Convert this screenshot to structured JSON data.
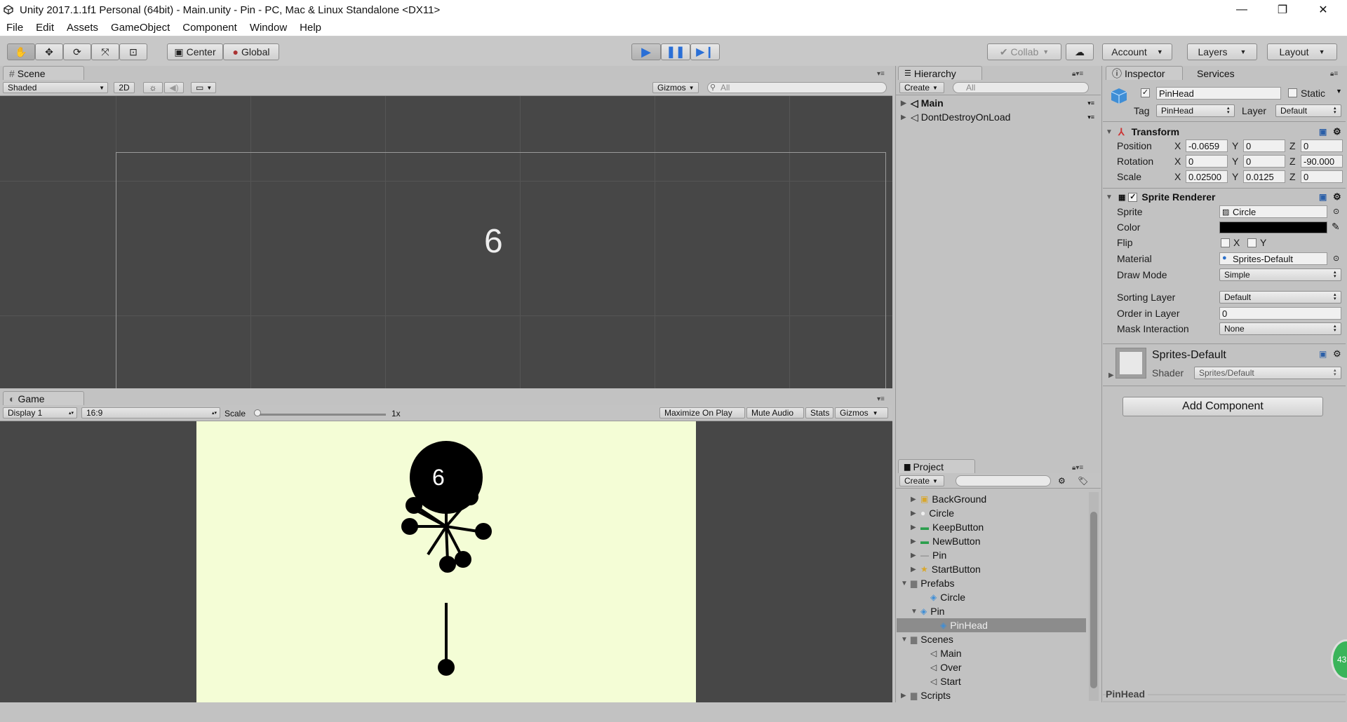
{
  "window": {
    "title": "Unity 2017.1.1f1 Personal (64bit) - Main.unity - Pin - PC, Mac & Linux Standalone <DX11>"
  },
  "menu": [
    "File",
    "Edit",
    "Assets",
    "GameObject",
    "Component",
    "Window",
    "Help"
  ],
  "toolbar": {
    "center": "Center",
    "global": "Global",
    "collab": "Collab",
    "account": "Account",
    "layers": "Layers",
    "layout": "Layout"
  },
  "scene": {
    "tab": "Scene",
    "shading": "Shaded",
    "mode2d": "2D",
    "gizmos": "Gizmos",
    "search_placeholder": "All",
    "overlay_number": "6"
  },
  "game": {
    "tab": "Game",
    "display": "Display 1",
    "aspect": "16:9",
    "scale_label": "Scale",
    "scale_value": "1x",
    "maximize": "Maximize On Play",
    "mute": "Mute Audio",
    "stats": "Stats",
    "gizmos": "Gizmos",
    "score": "6",
    "background_color": "#f4fdd6"
  },
  "hierarchy": {
    "tab": "Hierarchy",
    "create": "Create",
    "search_placeholder": "All",
    "items": [
      "Main",
      "DontDestroyOnLoad"
    ]
  },
  "project": {
    "tab": "Project",
    "create": "Create",
    "items": [
      {
        "label": "BackGround",
        "icon": "sprite-icon",
        "indent": 1,
        "arrow": "right"
      },
      {
        "label": "Circle",
        "icon": "circle-sprite-icon",
        "indent": 1,
        "arrow": "right"
      },
      {
        "label": "KeepButton",
        "icon": "button-sprite-icon",
        "indent": 1,
        "arrow": "right"
      },
      {
        "label": "NewButton",
        "icon": "button-sprite-icon",
        "indent": 1,
        "arrow": "right"
      },
      {
        "label": "Pin",
        "icon": "line-sprite-icon",
        "indent": 1,
        "arrow": "right"
      },
      {
        "label": "StartButton",
        "icon": "star-sprite-icon",
        "indent": 1,
        "arrow": "right"
      },
      {
        "label": "Prefabs",
        "icon": "folder-icon",
        "indent": 0,
        "arrow": "down"
      },
      {
        "label": "Circle",
        "icon": "prefab-icon",
        "indent": 2,
        "arrow": ""
      },
      {
        "label": "Pin",
        "icon": "prefab-icon",
        "indent": 1,
        "arrow": "down"
      },
      {
        "label": "PinHead",
        "icon": "prefab-icon",
        "indent": 3,
        "arrow": "",
        "selected": true
      },
      {
        "label": "Scenes",
        "icon": "folder-icon",
        "indent": 0,
        "arrow": "down"
      },
      {
        "label": "Main",
        "icon": "unity-scene-icon",
        "indent": 2,
        "arrow": ""
      },
      {
        "label": "Over",
        "icon": "unity-scene-icon",
        "indent": 2,
        "arrow": ""
      },
      {
        "label": "Start",
        "icon": "unity-scene-icon",
        "indent": 2,
        "arrow": ""
      },
      {
        "label": "Scripts",
        "icon": "folder-icon",
        "indent": 0,
        "arrow": "right"
      }
    ],
    "status": "PinHead"
  },
  "inspector": {
    "tab": "Inspector",
    "services": "Services",
    "object_name": "PinHead",
    "static_label": "Static",
    "tag_label": "Tag",
    "tag_value": "PinHead",
    "layer_label": "Layer",
    "layer_value": "Default",
    "transform": {
      "title": "Transform",
      "rows": [
        {
          "label": "Position",
          "x": "-0.0659",
          "y": "0",
          "z": "0"
        },
        {
          "label": "Rotation",
          "x": "0",
          "y": "0",
          "z": "-90.000"
        },
        {
          "label": "Scale",
          "x": "0.02500",
          "y": "0.0125",
          "z": "0"
        }
      ]
    },
    "sprite_renderer": {
      "title": "Sprite Renderer",
      "sprite_label": "Sprite",
      "sprite_value": "Circle",
      "color_label": "Color",
      "color_value": "#000000",
      "flip_label": "Flip",
      "flip_x": "X",
      "flip_y": "Y",
      "material_label": "Material",
      "material_value": "Sprites-Default",
      "draw_mode_label": "Draw Mode",
      "draw_mode_value": "Simple",
      "sorting_layer_label": "Sorting Layer",
      "sorting_layer_value": "Default",
      "order_label": "Order in Layer",
      "order_value": "0",
      "mask_label": "Mask Interaction",
      "mask_value": "None"
    },
    "material": {
      "name": "Sprites-Default",
      "shader_label": "Shader",
      "shader_value": "Sprites/Default"
    },
    "add_component": "Add Component"
  },
  "badge": "43"
}
